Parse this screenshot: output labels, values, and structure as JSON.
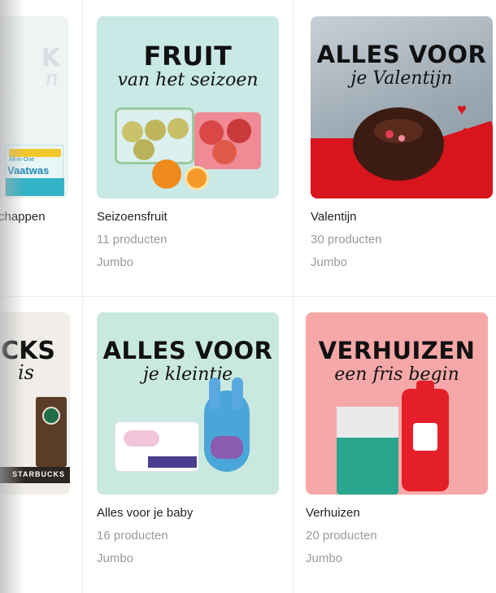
{
  "partial_left": {
    "top_label": "chappen",
    "top_headline": "K",
    "top_subline": "n",
    "top_pack_label_1": "All-in-One",
    "top_pack_label_2": "Vaatwas",
    "bottom_headline": "CKS",
    "bottom_subline": "is",
    "bottom_pack_label": "STARBUCKS"
  },
  "cards": [
    {
      "headline": "FRUIT",
      "subline": "van het seizoen",
      "name": "Seizoensfruit",
      "count": "11 producten",
      "brand": "Jumbo",
      "bg": "#c9e9e6"
    },
    {
      "headline": "ALLES VOOR",
      "subline": "je Valentijn",
      "name": "Valentijn",
      "count": "30 producten",
      "brand": "Jumbo",
      "bg": "#aeb9c2"
    },
    {
      "headline": "ALLES VOOR",
      "subline": "je kleintje",
      "name": "Alles voor je baby",
      "count": "16 producten",
      "brand": "Jumbo",
      "bg": "#c9e9e0"
    },
    {
      "headline": "VERHUIZEN",
      "subline": "een fris begin",
      "name": "Verhuizen",
      "count": "20 producten",
      "brand": "Jumbo",
      "bg": "#f6a8a8"
    }
  ]
}
